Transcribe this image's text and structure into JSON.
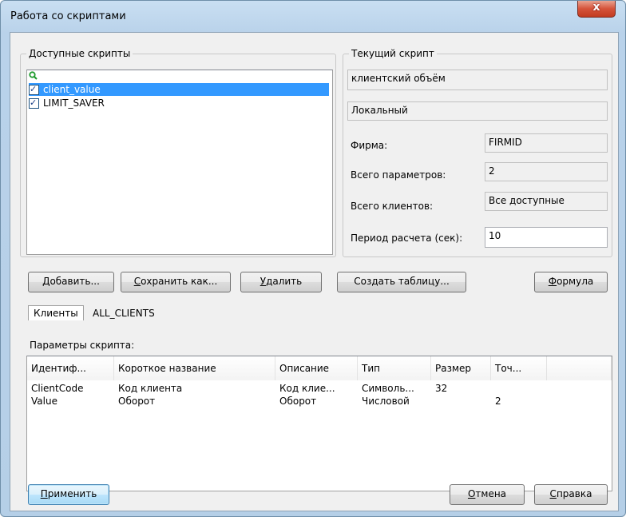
{
  "window": {
    "title": "Работа со скриптами",
    "close_label": "x"
  },
  "available": {
    "legend": "Доступные скрипты",
    "search_placeholder": "",
    "items": [
      {
        "label": "client_value",
        "checked": true,
        "selected": true
      },
      {
        "label": "LIMIT_SAVER",
        "checked": true,
        "selected": false
      }
    ]
  },
  "current": {
    "legend": "Текущий скрипт",
    "name_value": "клиентский объём",
    "type_value": "Локальный",
    "firm_label": "Фирма:",
    "firm_value": "FIRMID",
    "params_label": "Всего параметров:",
    "params_value": "2",
    "clients_label": "Всего клиентов:",
    "clients_value": "Все доступные",
    "period_label": "Период расчета (сек):",
    "period_value": "10"
  },
  "buttons": {
    "add": {
      "u": "Д",
      "rest": "обавить..."
    },
    "save_as": {
      "u": "С",
      "rest": "охранить как..."
    },
    "delete": {
      "u": "У",
      "rest": "далить"
    },
    "create_table": "Создать таблицу...",
    "formula": {
      "u": "Ф",
      "rest": "ормула"
    },
    "apply": {
      "u": "П",
      "rest": "рименить"
    },
    "cancel": {
      "u": "О",
      "rest": "тмена"
    },
    "help": {
      "u": "С",
      "rest": "правка"
    }
  },
  "clients": {
    "tab_label": "Клиенты",
    "value": "ALL_CLIENTS"
  },
  "params": {
    "title": "Параметры скрипта:",
    "columns": [
      "Идентиф...",
      "Короткое название",
      "Описание",
      "Тип",
      "Размер",
      "Точ..."
    ],
    "rows": [
      [
        "ClientCode",
        "Код клиента",
        "Код клие...",
        "Символь...",
        "32",
        ""
      ],
      [
        "Value",
        "Оборот",
        "Оборот",
        "Числовой",
        "",
        "2"
      ]
    ]
  }
}
